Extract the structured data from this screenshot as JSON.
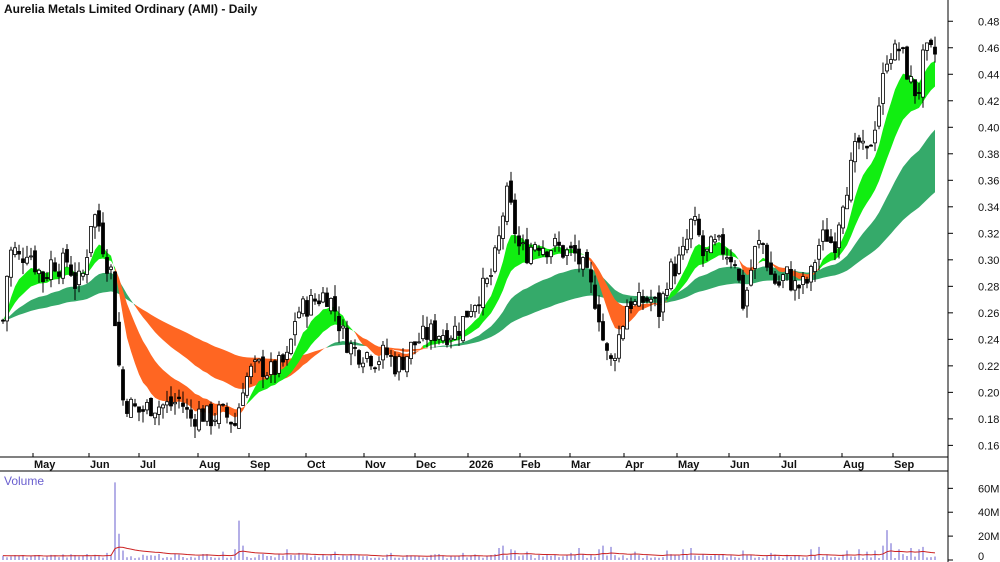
{
  "chart_data": [
    {
      "type": "candlestick",
      "title": "Aurelia Metals Limited Ordinary (AMI) - Daily",
      "ylim": [
        0.155,
        0.49
      ],
      "y_ticks": [
        "0.16",
        "0.18",
        "0.20",
        "0.22",
        "0.24",
        "0.26",
        "0.28",
        "0.30",
        "0.32",
        "0.34",
        "0.36",
        "0.38",
        "0.40",
        "0.42",
        "0.44",
        "0.46",
        "0.48"
      ],
      "x_ticks": [
        "May",
        "Jun",
        "Jul",
        "Aug",
        "Sep",
        "Oct",
        "Nov",
        "Dec",
        "2026",
        "Feb",
        "Mar",
        "Apr",
        "May",
        "Jun",
        "Jul",
        "Aug",
        "Sep"
      ],
      "grid": false,
      "price_anchors": [
        [
          0,
          0.215
        ],
        [
          5,
          0.28
        ],
        [
          12,
          0.31
        ],
        [
          20,
          0.3
        ],
        [
          28,
          0.31
        ],
        [
          36,
          0.295
        ],
        [
          44,
          0.285
        ],
        [
          52,
          0.3
        ],
        [
          60,
          0.295
        ],
        [
          68,
          0.3
        ],
        [
          76,
          0.28
        ],
        [
          84,
          0.29
        ],
        [
          92,
          0.335
        ],
        [
          98,
          0.33
        ],
        [
          106,
          0.3
        ],
        [
          112,
          0.29
        ],
        [
          116,
          0.245
        ],
        [
          122,
          0.195
        ],
        [
          130,
          0.19
        ],
        [
          140,
          0.185
        ],
        [
          150,
          0.19
        ],
        [
          160,
          0.19
        ],
        [
          170,
          0.19
        ],
        [
          180,
          0.195
        ],
        [
          190,
          0.18
        ],
        [
          200,
          0.185
        ],
        [
          210,
          0.18
        ],
        [
          220,
          0.185
        ],
        [
          230,
          0.18
        ],
        [
          236,
          0.175
        ],
        [
          242,
          0.205
        ],
        [
          250,
          0.215
        ],
        [
          260,
          0.22
        ],
        [
          270,
          0.215
        ],
        [
          280,
          0.22
        ],
        [
          288,
          0.225
        ],
        [
          296,
          0.26
        ],
        [
          306,
          0.265
        ],
        [
          316,
          0.27
        ],
        [
          326,
          0.275
        ],
        [
          334,
          0.265
        ],
        [
          342,
          0.245
        ],
        [
          350,
          0.235
        ],
        [
          358,
          0.23
        ],
        [
          366,
          0.23
        ],
        [
          376,
          0.225
        ],
        [
          386,
          0.23
        ],
        [
          396,
          0.22
        ],
        [
          404,
          0.225
        ],
        [
          412,
          0.235
        ],
        [
          420,
          0.24
        ],
        [
          430,
          0.245
        ],
        [
          440,
          0.245
        ],
        [
          450,
          0.245
        ],
        [
          460,
          0.25
        ],
        [
          470,
          0.265
        ],
        [
          480,
          0.275
        ],
        [
          490,
          0.285
        ],
        [
          498,
          0.31
        ],
        [
          506,
          0.35
        ],
        [
          512,
          0.335
        ],
        [
          518,
          0.31
        ],
        [
          526,
          0.305
        ],
        [
          536,
          0.315
        ],
        [
          546,
          0.31
        ],
        [
          556,
          0.31
        ],
        [
          566,
          0.305
        ],
        [
          574,
          0.305
        ],
        [
          582,
          0.295
        ],
        [
          590,
          0.28
        ],
        [
          598,
          0.265
        ],
        [
          604,
          0.235
        ],
        [
          610,
          0.22
        ],
        [
          616,
          0.235
        ],
        [
          622,
          0.25
        ],
        [
          628,
          0.27
        ],
        [
          636,
          0.265
        ],
        [
          644,
          0.27
        ],
        [
          652,
          0.27
        ],
        [
          660,
          0.26
        ],
        [
          668,
          0.29
        ],
        [
          676,
          0.295
        ],
        [
          684,
          0.305
        ],
        [
          692,
          0.33
        ],
        [
          698,
          0.32
        ],
        [
          704,
          0.3
        ],
        [
          712,
          0.31
        ],
        [
          720,
          0.31
        ],
        [
          728,
          0.305
        ],
        [
          736,
          0.3
        ],
        [
          742,
          0.265
        ],
        [
          748,
          0.28
        ],
        [
          754,
          0.305
        ],
        [
          762,
          0.315
        ],
        [
          770,
          0.29
        ],
        [
          778,
          0.28
        ],
        [
          786,
          0.29
        ],
        [
          794,
          0.28
        ],
        [
          802,
          0.28
        ],
        [
          810,
          0.285
        ],
        [
          818,
          0.31
        ],
        [
          826,
          0.32
        ],
        [
          834,
          0.31
        ],
        [
          842,
          0.345
        ],
        [
          850,
          0.365
        ],
        [
          858,
          0.39
        ],
        [
          866,
          0.375
        ],
        [
          874,
          0.4
        ],
        [
          882,
          0.43
        ],
        [
          888,
          0.46
        ],
        [
          894,
          0.455
        ],
        [
          900,
          0.46
        ],
        [
          906,
          0.445
        ],
        [
          912,
          0.43
        ],
        [
          918,
          0.425
        ],
        [
          924,
          0.455
        ]
      ],
      "series": [
        {
          "name": "",
          "role": "short-ema-ribbon",
          "colors": {
            "up": "#11ee11",
            "down": "#ff6622",
            "fading": "#f8b3b0"
          }
        },
        {
          "name": "",
          "role": "long-ema-ribbon",
          "colors": {
            "up": "#35aa6a",
            "down": "#ff6622"
          }
        }
      ],
      "candle_color": "#000000"
    },
    {
      "type": "bar",
      "title": "Volume",
      "ylim": [
        0,
        72000000
      ],
      "y_ticks": [
        "60M",
        "40M",
        "20M",
        "0"
      ],
      "spikes": [
        [
          12,
          3000000
        ],
        [
          32,
          3500000
        ],
        [
          56,
          4000000
        ],
        [
          88,
          5000000
        ],
        [
          108,
          6000000
        ],
        [
          116,
          65000000
        ],
        [
          120,
          22000000
        ],
        [
          124,
          8000000
        ],
        [
          160,
          5000000
        ],
        [
          176,
          5000000
        ],
        [
          204,
          5000000
        ],
        [
          222,
          7000000
        ],
        [
          236,
          9000000
        ],
        [
          240,
          33000000
        ],
        [
          244,
          12000000
        ],
        [
          262,
          5000000
        ],
        [
          286,
          9000000
        ],
        [
          300,
          6000000
        ],
        [
          336,
          7000000
        ],
        [
          352,
          5000000
        ],
        [
          392,
          6000000
        ],
        [
          440,
          5000000
        ],
        [
          462,
          6000000
        ],
        [
          500,
          10000000
        ],
        [
          504,
          12000000
        ],
        [
          510,
          9000000
        ],
        [
          516,
          8000000
        ],
        [
          526,
          7000000
        ],
        [
          570,
          6000000
        ],
        [
          580,
          10000000
        ],
        [
          600,
          9000000
        ],
        [
          604,
          12000000
        ],
        [
          610,
          11000000
        ],
        [
          636,
          7000000
        ],
        [
          668,
          8000000
        ],
        [
          684,
          9000000
        ],
        [
          690,
          10000000
        ],
        [
          742,
          8000000
        ],
        [
          770,
          6000000
        ],
        [
          810,
          9000000
        ],
        [
          818,
          11000000
        ],
        [
          846,
          8000000
        ],
        [
          858,
          9000000
        ],
        [
          866,
          7000000
        ],
        [
          874,
          8000000
        ],
        [
          884,
          12000000
        ],
        [
          888,
          25000000
        ],
        [
          892,
          14000000
        ],
        [
          900,
          9000000
        ],
        [
          910,
          10000000
        ],
        [
          918,
          9000000
        ],
        [
          924,
          11000000
        ]
      ],
      "avg_line_color": "#cc2222",
      "bar_color": "#6a5fcf"
    }
  ]
}
